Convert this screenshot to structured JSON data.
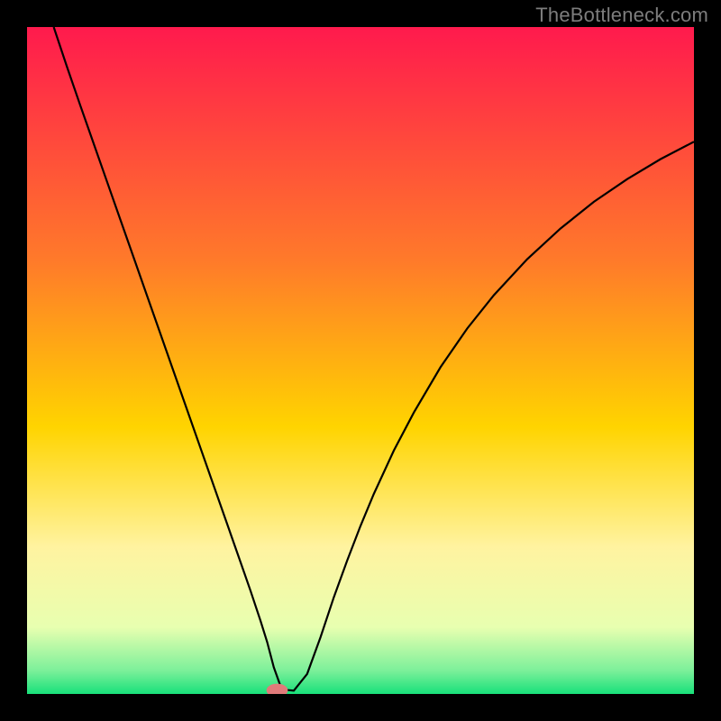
{
  "watermark": "TheBottleneck.com",
  "chart_data": {
    "type": "line",
    "title": "",
    "xlabel": "",
    "ylabel": "",
    "xlim": [
      0,
      100
    ],
    "ylim": [
      0,
      100
    ],
    "background_gradient": {
      "stops": [
        {
          "offset": 0.0,
          "color": "#ff1a4d"
        },
        {
          "offset": 0.35,
          "color": "#ff7a2a"
        },
        {
          "offset": 0.6,
          "color": "#ffd400"
        },
        {
          "offset": 0.78,
          "color": "#fff3a0"
        },
        {
          "offset": 0.9,
          "color": "#e8ffb0"
        },
        {
          "offset": 0.965,
          "color": "#7cf09a"
        },
        {
          "offset": 1.0,
          "color": "#18e07a"
        }
      ]
    },
    "marker": {
      "x": 37.5,
      "y": 0,
      "color": "#e07a7a",
      "rx": 1.6,
      "ry": 1.0
    },
    "curve_color": "#000000",
    "series": [
      {
        "name": "bottleneck-curve",
        "x": [
          4,
          6,
          8,
          10,
          12,
          14,
          16,
          18,
          20,
          22,
          24,
          26,
          28,
          30,
          32,
          33.5,
          35,
          36,
          37,
          38,
          39,
          40,
          42,
          44,
          46,
          48,
          50,
          52,
          55,
          58,
          62,
          66,
          70,
          75,
          80,
          85,
          90,
          95,
          100
        ],
        "y": [
          100,
          94,
          88.2,
          82.5,
          76.8,
          71.1,
          65.4,
          59.7,
          54.0,
          48.3,
          42.6,
          36.9,
          31.2,
          25.5,
          19.8,
          15.5,
          11.0,
          7.8,
          4.0,
          1.2,
          0.6,
          0.5,
          3.0,
          8.5,
          14.5,
          20.0,
          25.2,
          30.0,
          36.5,
          42.2,
          49.0,
          54.8,
          59.8,
          65.2,
          69.8,
          73.8,
          77.2,
          80.2,
          82.8
        ]
      }
    ]
  }
}
